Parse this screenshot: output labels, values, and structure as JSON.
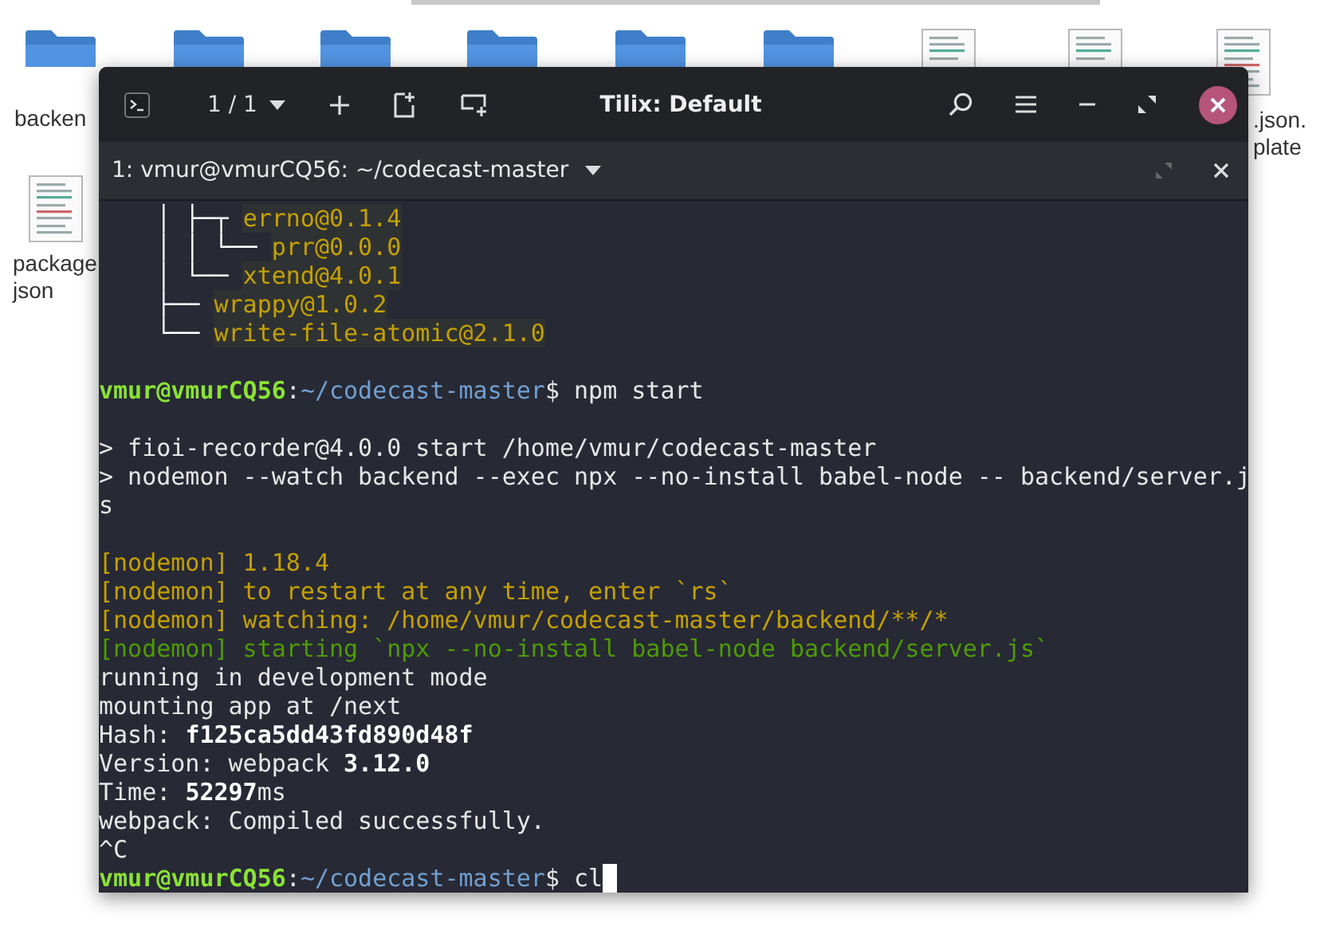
{
  "desktop_icons": [
    {
      "kind": "folder",
      "label": [
        "backen"
      ]
    },
    {
      "kind": "folder"
    },
    {
      "kind": "folder"
    },
    {
      "kind": "folder"
    },
    {
      "kind": "folder"
    },
    {
      "kind": "folder"
    },
    {
      "kind": "file"
    },
    {
      "kind": "file"
    },
    {
      "kind": "file",
      "label": [
        ".json.",
        "plate"
      ]
    },
    {
      "kind": "file",
      "label": [
        "package",
        "json"
      ]
    }
  ],
  "window": {
    "title": "Tilix: Default",
    "session": "1 / 1"
  },
  "tab": {
    "title": "1: vmur@vmurCQ56: ~/codecast-master"
  },
  "lines": [
    {
      "kind": "text",
      "segments": [
        {
          "kind": "tree",
          "text": "    │ ├─┬ "
        },
        {
          "kind": "pkg",
          "text": "errno@0.1.4"
        }
      ]
    },
    {
      "kind": "text",
      "segments": [
        {
          "kind": "tree",
          "text": "    │ │ └── "
        },
        {
          "kind": "pkg",
          "text": "prr@0.0.0"
        }
      ]
    },
    {
      "kind": "text",
      "segments": [
        {
          "kind": "tree",
          "text": "    │ └── "
        },
        {
          "kind": "pkg",
          "text": "xtend@4.0.1"
        }
      ]
    },
    {
      "kind": "text",
      "segments": [
        {
          "kind": "tree",
          "text": "    ├── "
        },
        {
          "kind": "pkg",
          "text": "wrappy@1.0.2"
        }
      ]
    },
    {
      "kind": "text",
      "segments": [
        {
          "kind": "tree",
          "text": "    └── "
        },
        {
          "kind": "pkg",
          "text": "write-file-atomic@2.1.0"
        }
      ]
    },
    {
      "kind": "blank"
    },
    {
      "kind": "text",
      "segments": [
        {
          "kind": "user",
          "text": "vmur@vmurCQ56"
        },
        {
          "kind": "plain",
          "text": ":"
        },
        {
          "kind": "path",
          "text": "~/codecast-master"
        },
        {
          "kind": "plain",
          "text": "$ npm start"
        }
      ]
    },
    {
      "kind": "blank"
    },
    {
      "kind": "text",
      "segments": [
        {
          "kind": "plain",
          "text": "> fioi-recorder@4.0.0 start /home/vmur/codecast-master"
        }
      ]
    },
    {
      "kind": "text",
      "segments": [
        {
          "kind": "plain",
          "text": "> nodemon --watch backend --exec npx --no-install babel-node -- backend/server.j"
        }
      ]
    },
    {
      "kind": "text",
      "segments": [
        {
          "kind": "plain",
          "text": "s"
        }
      ]
    },
    {
      "kind": "blank"
    },
    {
      "kind": "text",
      "segments": [
        {
          "kind": "yellow",
          "text": "[nodemon] 1.18.4"
        }
      ]
    },
    {
      "kind": "text",
      "segments": [
        {
          "kind": "yellow",
          "text": "[nodemon] to restart at any time, enter `rs`"
        }
      ]
    },
    {
      "kind": "text",
      "segments": [
        {
          "kind": "yellow",
          "text": "[nodemon] watching: /home/vmur/codecast-master/backend/**/*"
        }
      ]
    },
    {
      "kind": "text",
      "segments": [
        {
          "kind": "green",
          "text": "[nodemon] starting `npx --no-install babel-node backend/server.js`"
        }
      ]
    },
    {
      "kind": "text",
      "segments": [
        {
          "kind": "plain",
          "text": "running in development mode"
        }
      ]
    },
    {
      "kind": "text",
      "segments": [
        {
          "kind": "plain",
          "text": "mounting app at /next"
        }
      ]
    },
    {
      "kind": "text",
      "segments": [
        {
          "kind": "plain",
          "text": "Hash: "
        },
        {
          "kind": "bold",
          "text": "f125ca5dd43fd890d48f"
        }
      ]
    },
    {
      "kind": "text",
      "segments": [
        {
          "kind": "plain",
          "text": "Version: webpack "
        },
        {
          "kind": "bold",
          "text": "3.12.0"
        }
      ]
    },
    {
      "kind": "text",
      "segments": [
        {
          "kind": "plain",
          "text": "Time: "
        },
        {
          "kind": "bold",
          "text": "52297"
        },
        {
          "kind": "plain",
          "text": "ms"
        }
      ]
    },
    {
      "kind": "text",
      "segments": [
        {
          "kind": "plain",
          "text": "webpack: Compiled successfully."
        }
      ]
    },
    {
      "kind": "text",
      "segments": [
        {
          "kind": "plain",
          "text": "^C"
        }
      ]
    },
    {
      "kind": "text",
      "segments": [
        {
          "kind": "user",
          "text": "vmur@vmurCQ56"
        },
        {
          "kind": "plain",
          "text": ":"
        },
        {
          "kind": "path",
          "text": "~/codecast-master"
        },
        {
          "kind": "plain",
          "text": "$ cl"
        },
        {
          "kind": "cursor"
        }
      ]
    }
  ]
}
